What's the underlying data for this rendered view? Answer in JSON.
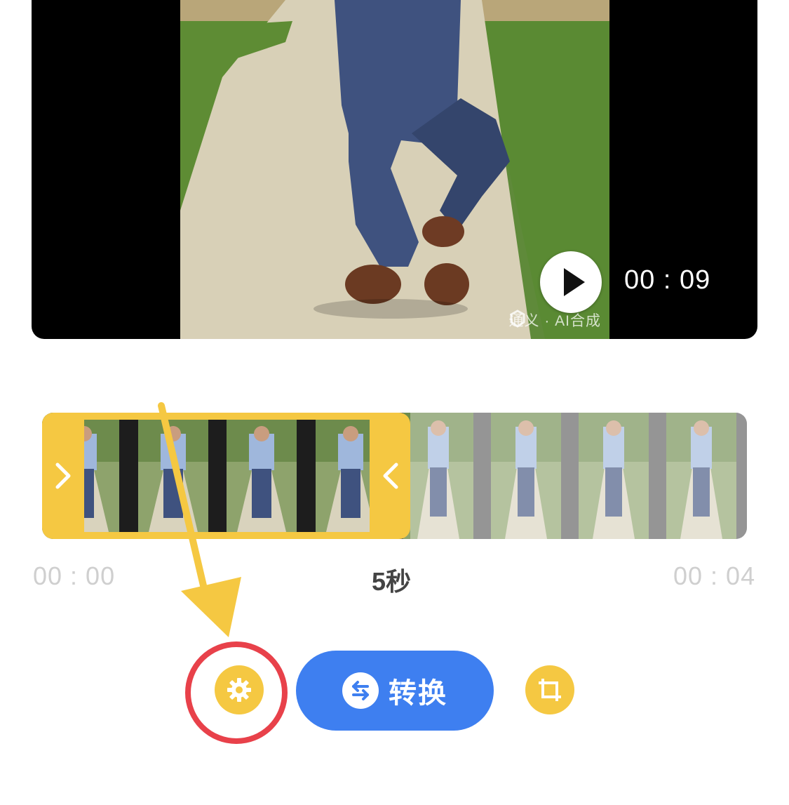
{
  "player": {
    "current_time": "00 : 09",
    "watermark": "通义 · AI合成",
    "play_icon": "play-icon"
  },
  "timeline": {
    "start_time": "00 : 00",
    "duration": "5秒",
    "end_time": "00 : 04",
    "left_handle_icon": "chevron-right-icon",
    "right_handle_icon": "chevron-left-icon"
  },
  "controls": {
    "settings_icon": "gear-icon",
    "convert_label": "转换",
    "convert_icon": "swap-arrows-icon",
    "crop_icon": "crop-icon"
  },
  "colors": {
    "accent_yellow": "#f5c842",
    "primary_blue": "#3e7ff0",
    "highlight_red": "#e8414a"
  }
}
